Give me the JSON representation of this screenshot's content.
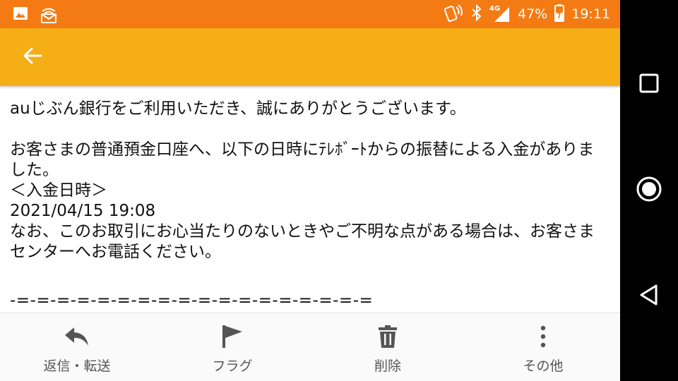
{
  "status_bar": {
    "network": "4G",
    "battery": "47%",
    "time": "19:11"
  },
  "colors": {
    "status_bar": "#F47A14",
    "app_bar": "#F5AE16",
    "bottom_bar": "#FAFAFA",
    "icon_gray": "#555555"
  },
  "message": {
    "lines": [
      "auじぶん銀行をご利用いただき、誠にありがとうございます。",
      "お客さまの普通預金口座へ、以下の日時にﾃﾚﾎﾞｰﾄからの振替による入金がありました。",
      "＜入金日時＞",
      "2021/04/15 19:08",
      "なお、このお取引にお心当たりのないときやご不明な点がある場合は、お客さまセンターへお電話ください。",
      "-=-=-=-=-=-=-=-=-=-=-=-=-=-=-=-=-=-="
    ]
  },
  "actions": {
    "reply": "返信・転送",
    "flag": "フラグ",
    "delete": "削除",
    "more": "その他"
  }
}
